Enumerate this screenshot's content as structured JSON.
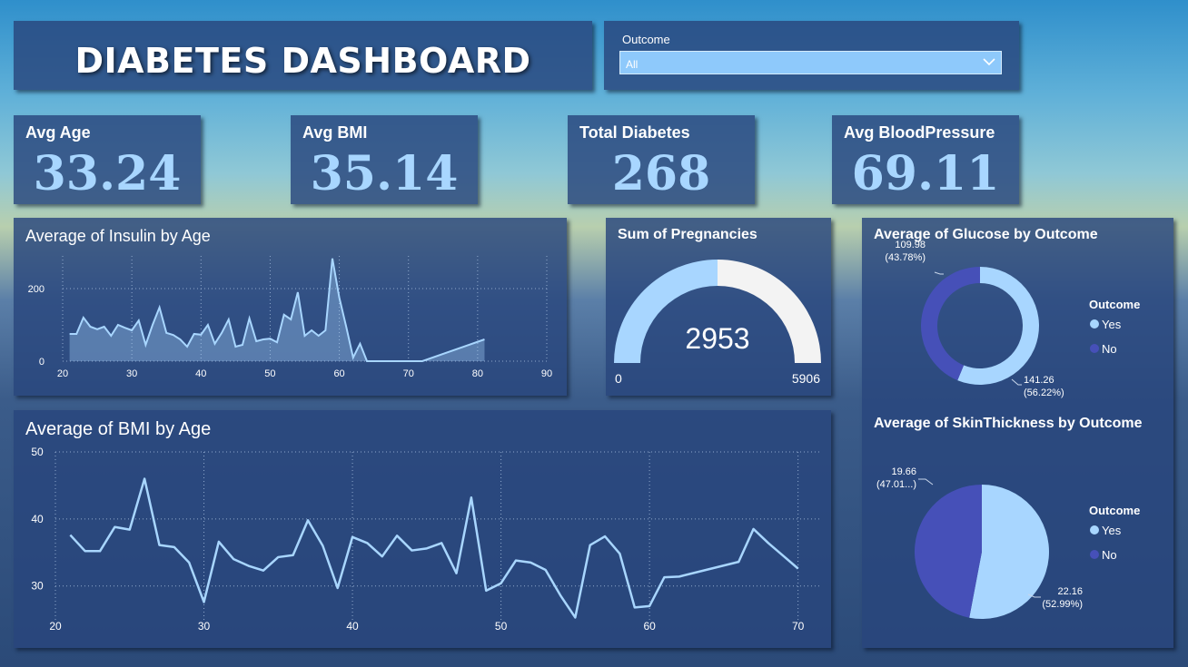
{
  "header": {
    "title": "DIABETES DASHBOARD"
  },
  "slicer": {
    "label": "Outcome",
    "value": "All"
  },
  "kpis": [
    {
      "label": "Avg Age",
      "value": "33.24"
    },
    {
      "label": "Avg BMI",
      "value": "35.14"
    },
    {
      "label": "Total Diabetes",
      "value": "268"
    },
    {
      "label": "Avg BloodPressure",
      "value": "69.11"
    }
  ],
  "colors": {
    "light": "#a8d6ff",
    "dark": "#4650b8",
    "gaugeRest": "#f3f3f3"
  },
  "chart_data": [
    {
      "type": "area",
      "title": "Average of Insulin by Age",
      "xlim": [
        20,
        90
      ],
      "ylim": [
        0,
        290
      ],
      "xticks": [
        20,
        30,
        40,
        50,
        60,
        70,
        80,
        90
      ],
      "yticks": [
        0,
        200
      ],
      "x": [
        21,
        22,
        23,
        24,
        25,
        26,
        27,
        28,
        29,
        30,
        31,
        32,
        33,
        34,
        35,
        36,
        37,
        38,
        39,
        40,
        41,
        42,
        43,
        44,
        45,
        46,
        47,
        48,
        49,
        50,
        51,
        52,
        53,
        54,
        55,
        56,
        57,
        58,
        59,
        60,
        61,
        62,
        63,
        64,
        65,
        66,
        67,
        68,
        69,
        70,
        72,
        81
      ],
      "y": [
        75,
        75,
        120,
        95,
        88,
        95,
        70,
        100,
        92,
        85,
        112,
        45,
        100,
        148,
        78,
        72,
        60,
        40,
        75,
        73,
        100,
        48,
        78,
        115,
        40,
        45,
        118,
        55,
        60,
        62,
        52,
        128,
        115,
        190,
        70,
        85,
        70,
        85,
        283,
        175,
        95,
        10,
        48,
        0,
        0,
        0,
        0,
        0,
        0,
        0,
        0,
        60
      ]
    },
    {
      "type": "line",
      "title": "Average of BMI by Age",
      "xlim": [
        20,
        71
      ],
      "ylim": [
        24,
        50
      ],
      "xticks": [
        20,
        30,
        40,
        50,
        60,
        70
      ],
      "yticks": [
        30,
        40,
        50
      ],
      "x": [
        21,
        22,
        23,
        24,
        25,
        26,
        27,
        28,
        29,
        30,
        31,
        32,
        33,
        34,
        35,
        36,
        37,
        38,
        39,
        40,
        41,
        42,
        43,
        44,
        45,
        46,
        47,
        48,
        49,
        50,
        51,
        52,
        53,
        54,
        55,
        56,
        57,
        58,
        59,
        60,
        61,
        62,
        66,
        67,
        68,
        69,
        70
      ],
      "y": [
        37.6,
        35.2,
        35.2,
        38.8,
        38.4,
        46,
        36.1,
        35.8,
        33.5,
        27.6,
        36.6,
        34,
        33,
        32.3,
        34.3,
        34.6,
        39.8,
        36,
        29.7,
        37.3,
        36.4,
        34.4,
        37.5,
        35.3,
        35.6,
        36.4,
        31.9,
        43.2,
        29.3,
        30.4,
        33.8,
        33.5,
        32.4,
        28.6,
        25.3,
        36.1,
        37.4,
        34.8,
        26.8,
        27,
        31.3,
        31.4,
        33.6,
        38.5,
        36.4,
        34.5,
        32.6
      ]
    },
    {
      "type": "gauge",
      "title": "Sum of Pregnancies",
      "value": 2953,
      "value_label": "2953",
      "min_label": "0",
      "max_label": "5906",
      "max": 5906
    },
    {
      "type": "pie",
      "subtype": "donut",
      "title": "Average of Glucose by Outcome",
      "legend_title": "Outcome",
      "categories": [
        "Yes",
        "No"
      ],
      "values": [
        141.26,
        109.98
      ],
      "labels": [
        [
          "141.26",
          "(56.22%)"
        ],
        [
          "109.98",
          "(43.78%)"
        ]
      ]
    },
    {
      "type": "pie",
      "title": "Average of SkinThickness by Outcome",
      "legend_title": "Outcome",
      "categories": [
        "Yes",
        "No"
      ],
      "values": [
        22.16,
        19.66
      ],
      "labels": [
        [
          "22.16",
          "(52.99%)"
        ],
        [
          "19.66",
          "(47.01...)"
        ]
      ]
    }
  ]
}
